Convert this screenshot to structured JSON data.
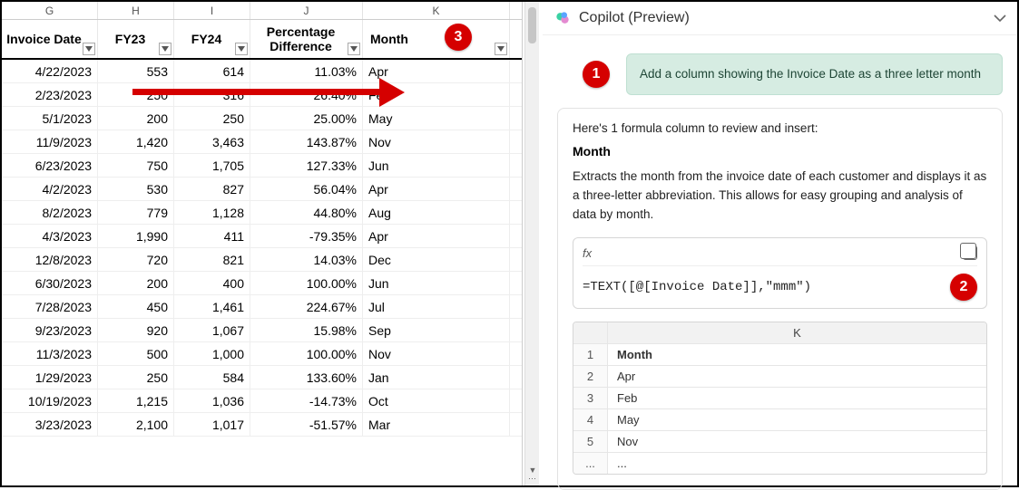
{
  "columns": {
    "letters": [
      "G",
      "H",
      "I",
      "J",
      "K"
    ],
    "headers": [
      "Invoice Date",
      "FY23",
      "FY24",
      "Percentage Difference",
      "Month"
    ]
  },
  "rows": [
    {
      "date": "4/22/2023",
      "fy23": "553",
      "fy24": "614",
      "pct": "11.03%",
      "month": "Apr"
    },
    {
      "date": "2/23/2023",
      "fy23": "250",
      "fy24": "316",
      "pct": "26.40%",
      "month": "Feb"
    },
    {
      "date": "5/1/2023",
      "fy23": "200",
      "fy24": "250",
      "pct": "25.00%",
      "month": "May"
    },
    {
      "date": "11/9/2023",
      "fy23": "1,420",
      "fy24": "3,463",
      "pct": "143.87%",
      "month": "Nov"
    },
    {
      "date": "6/23/2023",
      "fy23": "750",
      "fy24": "1,705",
      "pct": "127.33%",
      "month": "Jun"
    },
    {
      "date": "4/2/2023",
      "fy23": "530",
      "fy24": "827",
      "pct": "56.04%",
      "month": "Apr"
    },
    {
      "date": "8/2/2023",
      "fy23": "779",
      "fy24": "1,128",
      "pct": "44.80%",
      "month": "Aug"
    },
    {
      "date": "4/3/2023",
      "fy23": "1,990",
      "fy24": "411",
      "pct": "-79.35%",
      "month": "Apr"
    },
    {
      "date": "12/8/2023",
      "fy23": "720",
      "fy24": "821",
      "pct": "14.03%",
      "month": "Dec"
    },
    {
      "date": "6/30/2023",
      "fy23": "200",
      "fy24": "400",
      "pct": "100.00%",
      "month": "Jun"
    },
    {
      "date": "7/28/2023",
      "fy23": "450",
      "fy24": "1,461",
      "pct": "224.67%",
      "month": "Jul"
    },
    {
      "date": "9/23/2023",
      "fy23": "920",
      "fy24": "1,067",
      "pct": "15.98%",
      "month": "Sep"
    },
    {
      "date": "11/3/2023",
      "fy23": "500",
      "fy24": "1,000",
      "pct": "100.00%",
      "month": "Nov"
    },
    {
      "date": "1/29/2023",
      "fy23": "250",
      "fy24": "584",
      "pct": "133.60%",
      "month": "Jan"
    },
    {
      "date": "10/19/2023",
      "fy23": "1,215",
      "fy24": "1,036",
      "pct": "-14.73%",
      "month": "Oct"
    },
    {
      "date": "3/23/2023",
      "fy23": "2,100",
      "fy24": "1,017",
      "pct": "-51.57%",
      "month": "Mar"
    }
  ],
  "copilot": {
    "title": "Copilot (Preview)",
    "user_prompt": "Add a column showing the Invoice Date as a three letter month",
    "intro": "Here's 1 formula column to review and insert:",
    "col_name": "Month",
    "description": "Extracts the month from the invoice date of each customer and displays it as a three-letter abbreviation. This allows for easy grouping and analysis of data by month.",
    "fx_label": "fx",
    "formula": "=TEXT([@[Invoice Date]],\"mmm\")",
    "preview": {
      "col_letter": "K",
      "header": "Month",
      "rows": [
        {
          "idx": "1",
          "val": "Month",
          "bold": true
        },
        {
          "idx": "2",
          "val": "Apr"
        },
        {
          "idx": "3",
          "val": "Feb"
        },
        {
          "idx": "4",
          "val": "May"
        },
        {
          "idx": "5",
          "val": "Nov"
        },
        {
          "idx": "...",
          "val": "..."
        }
      ]
    }
  },
  "annotations": {
    "b1": "1",
    "b2": "2",
    "b3": "3"
  }
}
